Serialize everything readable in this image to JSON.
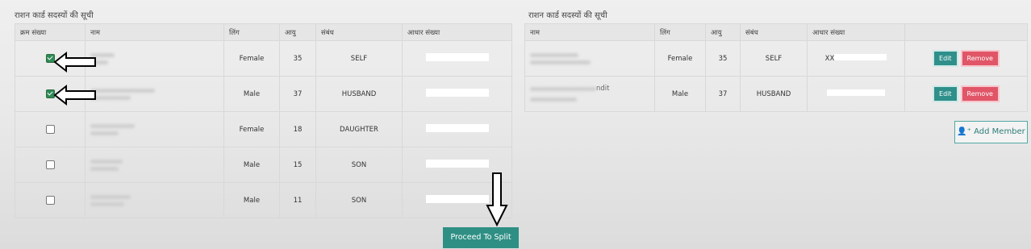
{
  "left": {
    "title": "राशन कार्ड सदस्यों की सूची",
    "headers": [
      "क्रम संख्या",
      "नाम",
      "लिंग",
      "आयु",
      "संबंध",
      "आधार संख्या"
    ],
    "rows": [
      {
        "checked": true,
        "gender": "Female",
        "age": "35",
        "relation": "SELF"
      },
      {
        "checked": true,
        "gender": "Male",
        "age": "37",
        "relation": "HUSBAND"
      },
      {
        "checked": false,
        "gender": "Female",
        "age": "18",
        "relation": "DAUGHTER"
      },
      {
        "checked": false,
        "gender": "Male",
        "age": "15",
        "relation": "SON"
      },
      {
        "checked": false,
        "gender": "Male",
        "age": "11",
        "relation": "SON"
      }
    ],
    "proceed_label": "Proceed To Split"
  },
  "right": {
    "title": "राशन कार्ड सदस्यों की सूची",
    "headers": [
      "नाम",
      "लिंग",
      "आयु",
      "संबंध",
      "आधार संख्या",
      ""
    ],
    "rows": [
      {
        "name_partial": "",
        "gender": "Female",
        "age": "35",
        "relation": "SELF",
        "aadhaar_partial": "XX"
      },
      {
        "name_partial": "ndit",
        "gender": "Male",
        "age": "37",
        "relation": "HUSBAND",
        "aadhaar_partial": ""
      }
    ],
    "edit_label": "Edit",
    "remove_label": "Remove",
    "add_member_label": "Add Member"
  },
  "colors": {
    "teal": "#2f8f84",
    "remove_red": "#e05567",
    "checked_green": "#2e8b57"
  }
}
